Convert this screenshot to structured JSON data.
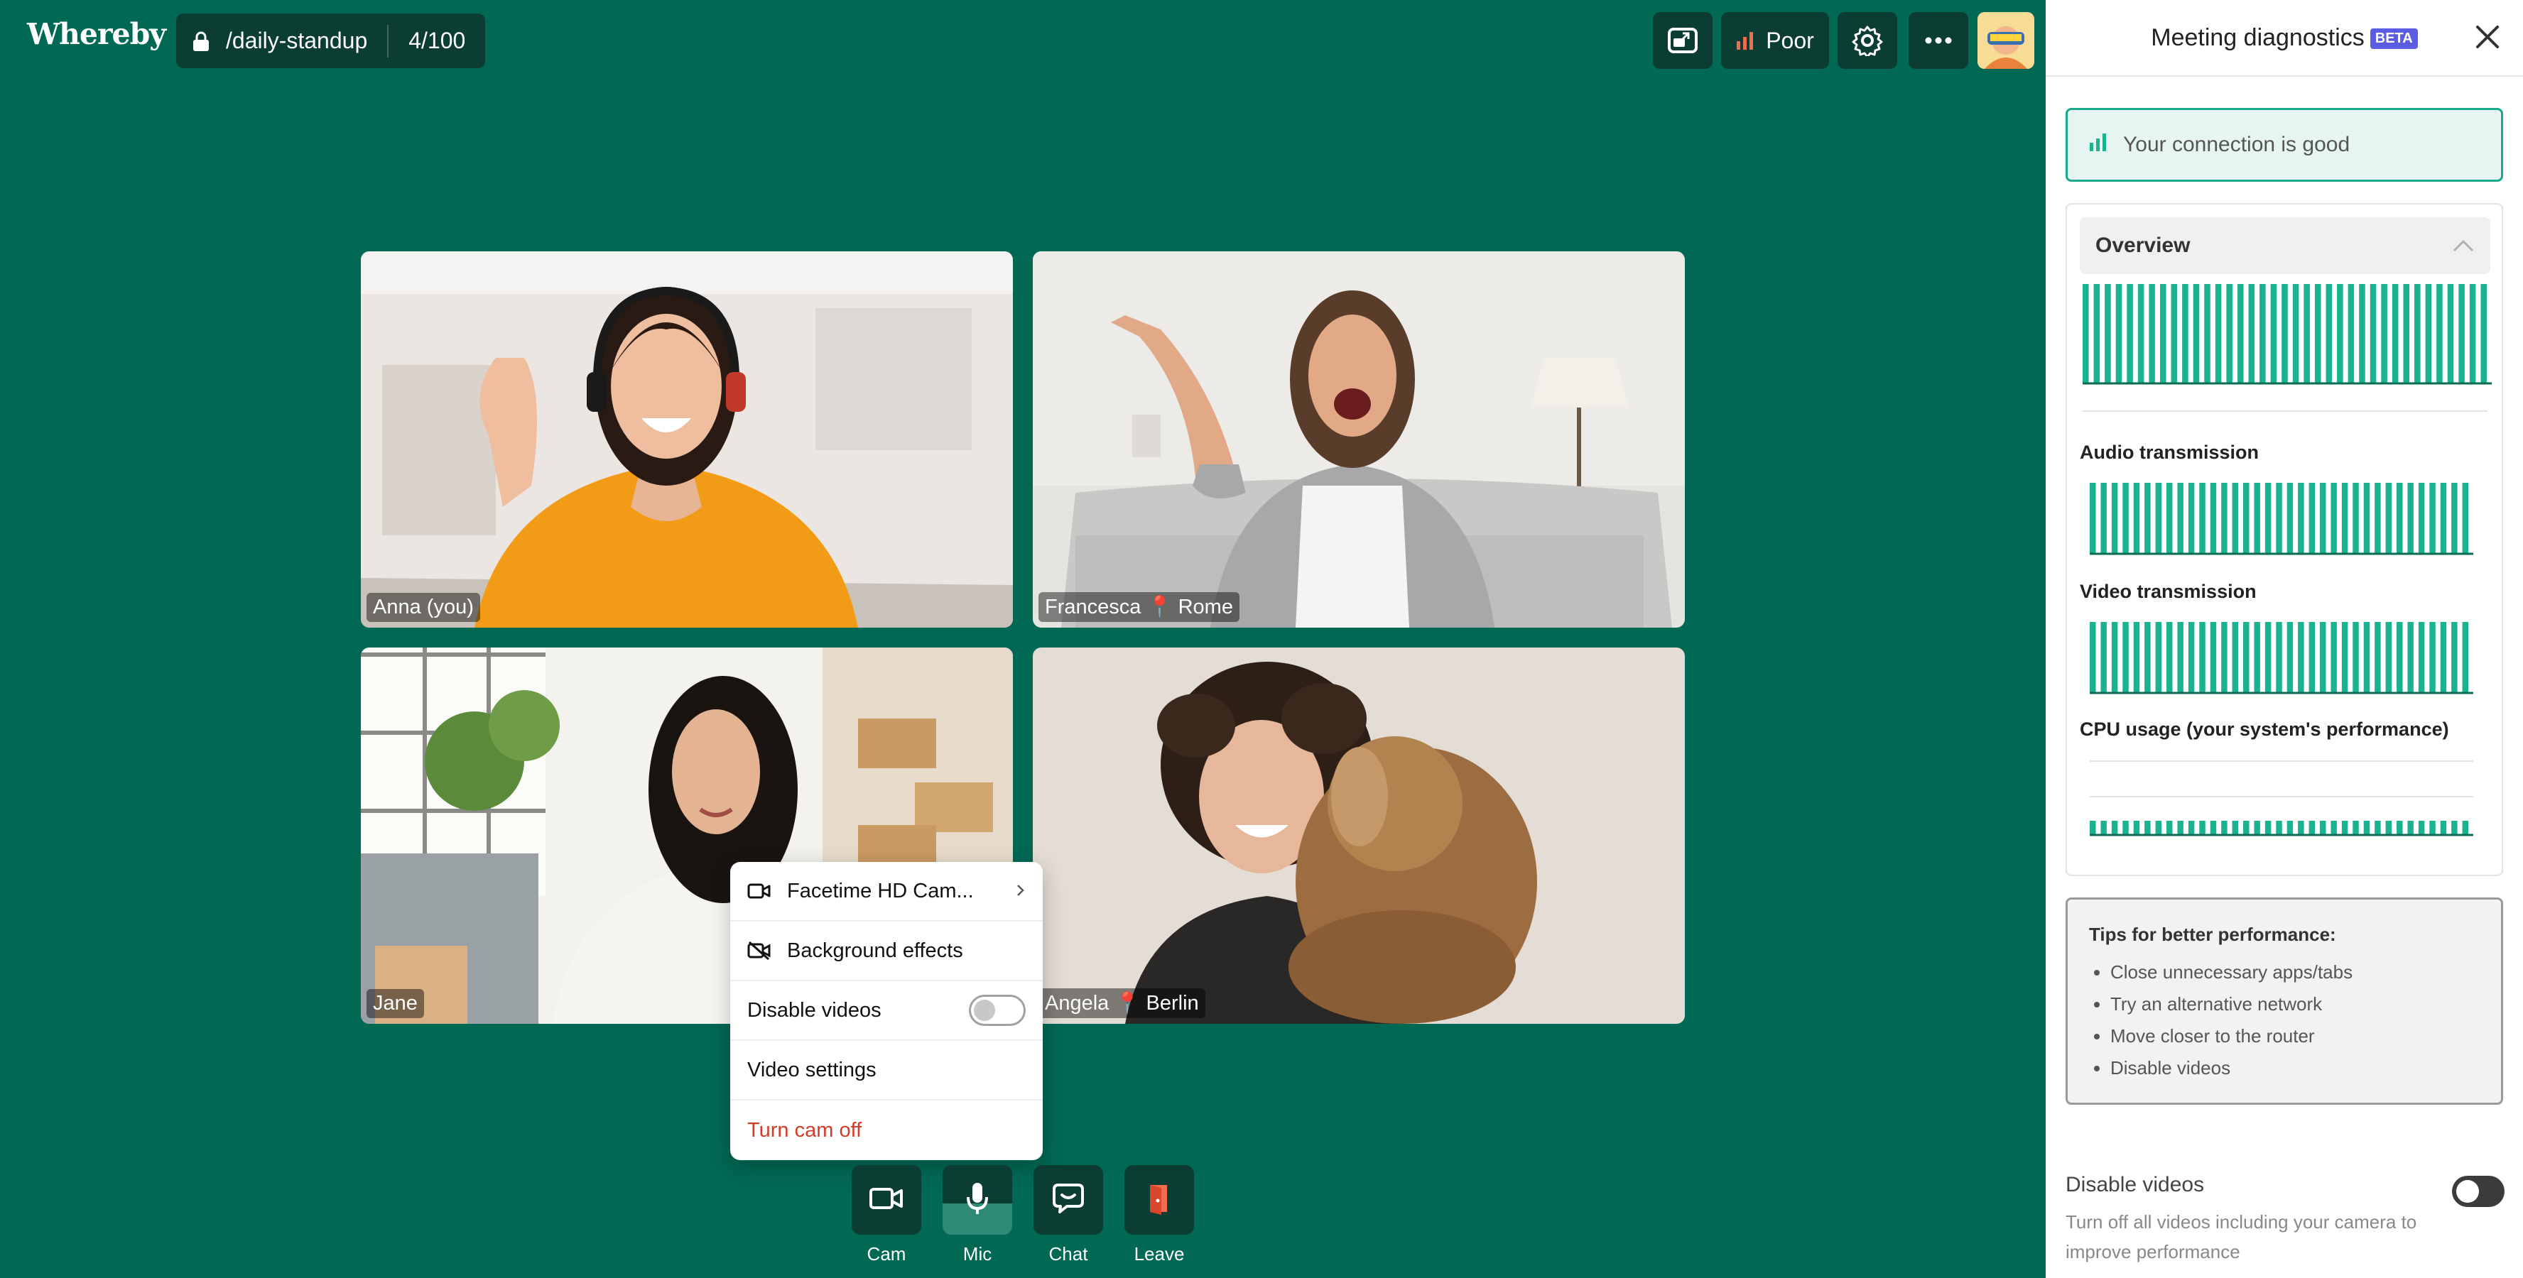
{
  "app": {
    "logo": "Whereby"
  },
  "room": {
    "name": "/daily-standup",
    "count": "4/100"
  },
  "topbar": {
    "connection_label": "Poor",
    "connection_color": "#f26b4f"
  },
  "participants": [
    {
      "name": "Anna (you)"
    },
    {
      "name": "Francesca 📍 Rome"
    },
    {
      "name": "Jane"
    },
    {
      "name": "Angela 📍 Berlin"
    }
  ],
  "cam_menu": {
    "camera": "Facetime HD Cam...",
    "background_effects": "Background effects",
    "disable_videos": "Disable videos",
    "video_settings": "Video settings",
    "turn_cam_off": "Turn cam off"
  },
  "controls": {
    "cam": "Cam",
    "mic": "Mic",
    "chat": "Chat",
    "leave": "Leave"
  },
  "panel": {
    "title": "Meeting diagnostics",
    "beta": "BETA",
    "connection_status": "Your connection is good",
    "overview": "Overview",
    "audio": "Audio transmission",
    "video": "Video transmission",
    "cpu": "CPU usage (your system's performance)",
    "tips_title": "Tips for better performance:",
    "tips": [
      "Close unnecessary apps/tabs",
      "Try an alternative network",
      "Move closer to the router",
      "Disable videos"
    ],
    "disable_title": "Disable videos",
    "disable_desc": "Turn off all videos including your camera to improve performance",
    "accent_color": "#1bb38f"
  }
}
